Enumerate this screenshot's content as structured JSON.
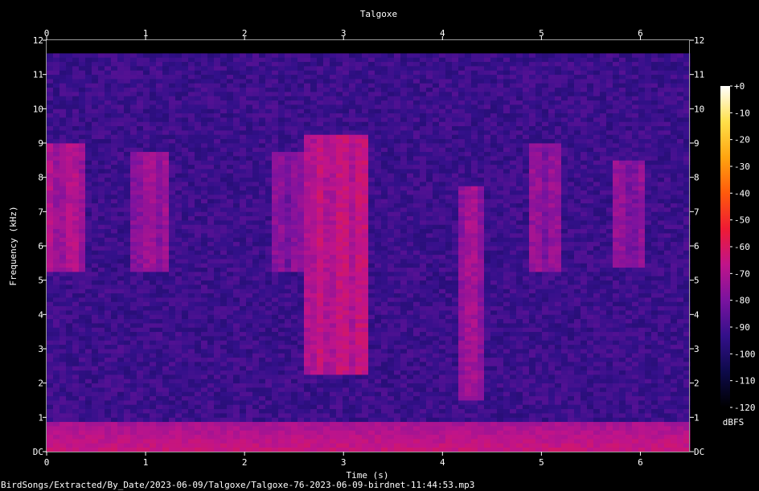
{
  "chart_data": {
    "type": "heatmap",
    "title": "Talgoxe",
    "xlabel": "Time (s)",
    "ylabel": "Frequency (kHz)",
    "xlim": [
      0,
      6.5
    ],
    "ylim": [
      0,
      12
    ],
    "x_ticks": [
      {
        "value": 0,
        "label": "0"
      },
      {
        "value": 1,
        "label": "1"
      },
      {
        "value": 2,
        "label": "2"
      },
      {
        "value": 3,
        "label": "3"
      },
      {
        "value": 4,
        "label": "4"
      },
      {
        "value": 5,
        "label": "5"
      },
      {
        "value": 6,
        "label": "6"
      }
    ],
    "y_ticks": [
      {
        "value": 0,
        "label": "DC"
      },
      {
        "value": 1,
        "label": "1"
      },
      {
        "value": 2,
        "label": "2"
      },
      {
        "value": 3,
        "label": "3"
      },
      {
        "value": 4,
        "label": "4"
      },
      {
        "value": 5,
        "label": "5"
      },
      {
        "value": 6,
        "label": "6"
      },
      {
        "value": 7,
        "label": "7"
      },
      {
        "value": 8,
        "label": "8"
      },
      {
        "value": 9,
        "label": "9"
      },
      {
        "value": 10,
        "label": "10"
      },
      {
        "value": 11,
        "label": "11"
      },
      {
        "value": 12,
        "label": "12"
      }
    ],
    "colorbar": {
      "unit_label": "dBFS",
      "range": [
        -120,
        0
      ],
      "ticks": [
        {
          "value": 0,
          "label": "+0"
        },
        {
          "value": -10,
          "label": "-10"
        },
        {
          "value": -20,
          "label": "-20"
        },
        {
          "value": -30,
          "label": "-30"
        },
        {
          "value": -40,
          "label": "-40"
        },
        {
          "value": -50,
          "label": "-50"
        },
        {
          "value": -60,
          "label": "-60"
        },
        {
          "value": -70,
          "label": "-70"
        },
        {
          "value": -80,
          "label": "-80"
        },
        {
          "value": -90,
          "label": "-90"
        },
        {
          "value": -100,
          "label": "-100"
        },
        {
          "value": -110,
          "label": "-110"
        },
        {
          "value": -120,
          "label": "-120"
        }
      ],
      "stops": [
        "#000000",
        "#0d0a4a",
        "#33108a",
        "#7a139f",
        "#c0148a",
        "#ef1b34",
        "#ff5a0c",
        "#ffa410",
        "#ffe049",
        "#ffffff"
      ]
    },
    "background_level_dbfs": -92,
    "upper_cutoff_khz": 11.6,
    "low_frequency_band": {
      "f_max": 0.9,
      "level_dbfs": -72
    },
    "calls": [
      {
        "t0": 0.02,
        "t1": 0.36,
        "f0": 5.3,
        "f1": 9.0,
        "level_dbfs": -72
      },
      {
        "t0": 0.85,
        "t1": 1.25,
        "f0": 5.2,
        "f1": 8.8,
        "level_dbfs": -76
      },
      {
        "t0": 2.3,
        "t1": 2.6,
        "f0": 5.2,
        "f1": 8.8,
        "level_dbfs": -80
      },
      {
        "t0": 2.6,
        "t1": 3.25,
        "f0": 2.3,
        "f1": 9.2,
        "level_dbfs": -68
      },
      {
        "t0": 4.15,
        "t1": 4.4,
        "f0": 1.5,
        "f1": 7.8,
        "level_dbfs": -75
      },
      {
        "t0": 4.85,
        "t1": 5.2,
        "f0": 5.3,
        "f1": 9.0,
        "level_dbfs": -78
      },
      {
        "t0": 5.75,
        "t1": 6.05,
        "f0": 5.4,
        "f1": 8.5,
        "level_dbfs": -78
      }
    ]
  },
  "footer": {
    "filename": "BirdSongs/Extracted/By_Date/2023-06-09/Talgoxe/Talgoxe-76-2023-06-09-birdnet-11:44:53.mp3"
  }
}
